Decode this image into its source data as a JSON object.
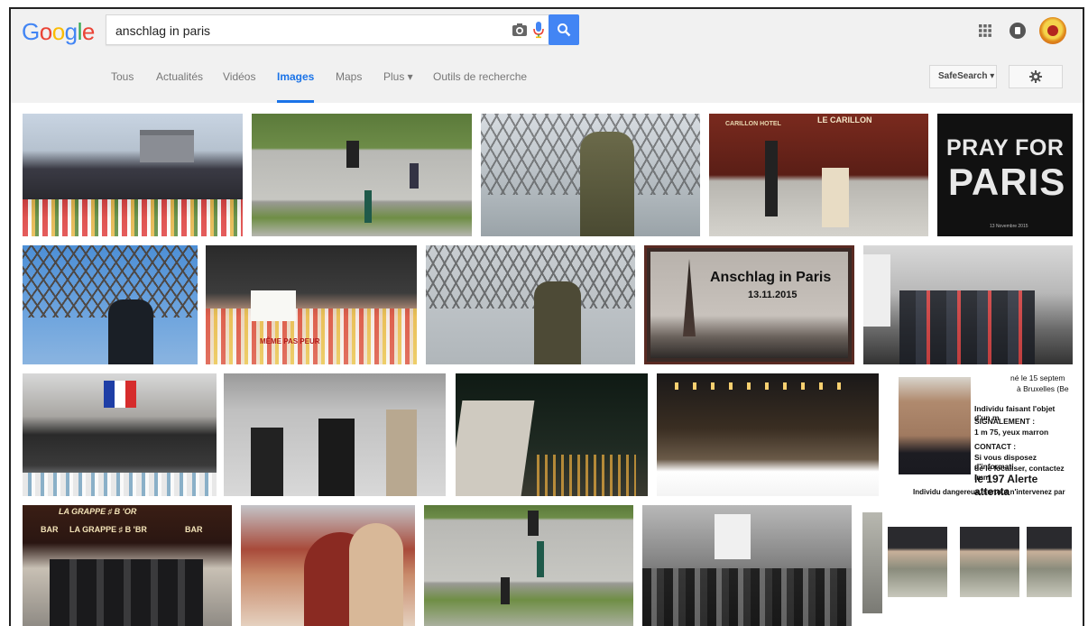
{
  "search": {
    "query": "anschlag in paris"
  },
  "logo": {
    "letters": [
      "G",
      "o",
      "o",
      "g",
      "l",
      "e"
    ],
    "colors": [
      "#4285f4",
      "#ea4335",
      "#fbbc05",
      "#4285f4",
      "#34a853",
      "#ea4335"
    ]
  },
  "nav": {
    "tabs": [
      {
        "label": "Tous"
      },
      {
        "label": "Actualités"
      },
      {
        "label": "Vidéos"
      },
      {
        "label": "Images"
      },
      {
        "label": "Maps"
      },
      {
        "label": "Plus ▾"
      },
      {
        "label": "Outils de recherche"
      }
    ],
    "safesearch_label": "SafeSearch ▾"
  },
  "icons": {
    "camera": "camera-icon",
    "mic": "mic-icon",
    "search": "search-icon",
    "apps": "apps-grid-icon",
    "notifications": "notifications-icon",
    "settings": "gear-icon"
  },
  "colors": {
    "accent": "#4285f4",
    "active_tab": "#1a73e8",
    "header_bg": "#f1f1f1"
  },
  "results": {
    "pray_for": "PRAY FOR",
    "paris": "PARIS",
    "pray_date": "13 Novembre 2015",
    "anschlag_title": "Anschlag in Paris",
    "anschlag_date": "13.11.2015",
    "carillon_sign": "LE CARILLON",
    "carillon_hotel": "CARILLON HOTEL",
    "grappe_sign": "LA GRAPPE ♯ B 'BR",
    "grappe_bar_left": "BAR",
    "grappe_bar_right": "BAR",
    "grappe_sign_top": "LA GRAPPE ♯ B 'OR",
    "meme_sign": "MÊME PAS PEUR",
    "doc_lines": [
      "né le 15 septem",
      "à Bruxelles (Be",
      "Individu faisant l'objet d'un m",
      "SIGNALEMENT :",
      "1 m 75, yeux marron",
      "CONTACT :",
      "Si vous disposez d'informati",
      "de le localiser, contactez imm",
      "le 197 Alerte attenta",
      "Individu dangereux, surtout n'intervenez par"
    ]
  }
}
